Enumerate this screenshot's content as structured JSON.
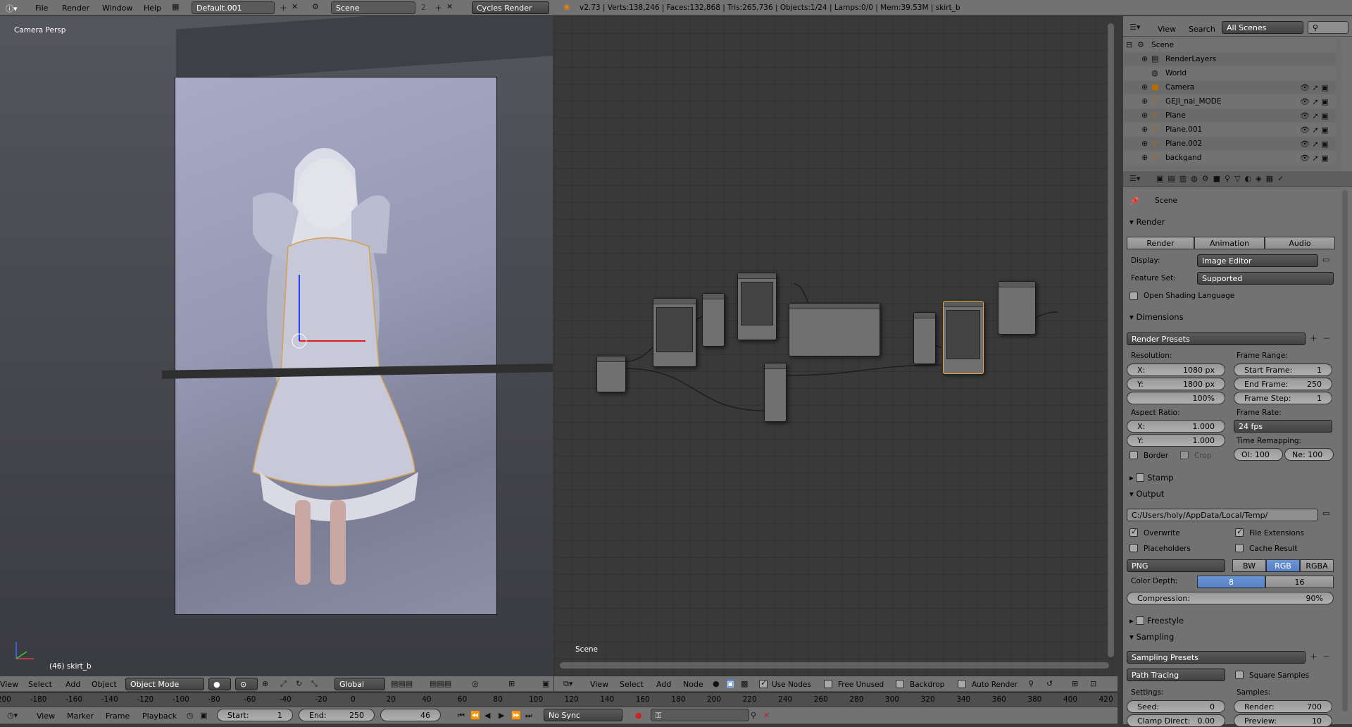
{
  "info_bar": {
    "menu": [
      "File",
      "Render",
      "Window",
      "Help"
    ],
    "screen_layout": "Default.001",
    "scene": "Scene",
    "scene_users": "2",
    "engine": "Cycles Render",
    "stats": "v2.73 | Verts:138,246 | Faces:132,868 | Tris:265,736 | Objects:1/24 | Lamps:0/0 | Mem:39.53M | skirt_b"
  },
  "viewport": {
    "view_name": "Camera Persp",
    "object_label": "(46) skirt_b",
    "header": {
      "menu": [
        "View",
        "Select",
        "Add",
        "Object"
      ],
      "mode": "Object Mode",
      "orientation": "Global"
    }
  },
  "node_editor": {
    "scene_label": "Scene",
    "header": {
      "menu": [
        "View",
        "Select",
        "Add",
        "Node"
      ],
      "use_nodes": "Use Nodes",
      "free_unused": "Free Unused",
      "backdrop": "Backdrop",
      "auto_render": "Auto Render"
    }
  },
  "outliner": {
    "header": {
      "view": "View",
      "search": "Search",
      "filter": "All Scenes"
    },
    "items": [
      {
        "name": "Scene",
        "level": 0
      },
      {
        "name": "RenderLayers",
        "level": 1
      },
      {
        "name": "World",
        "level": 1
      },
      {
        "name": "Camera",
        "level": 1
      },
      {
        "name": "GEJI_nai_MODE",
        "level": 1
      },
      {
        "name": "Plane",
        "level": 1
      },
      {
        "name": "Plane.001",
        "level": 1
      },
      {
        "name": "Plane.002",
        "level": 1
      },
      {
        "name": "backgand",
        "level": 1
      }
    ]
  },
  "properties": {
    "context": "Scene",
    "render": {
      "title": "Render",
      "buttons": [
        "Render",
        "Animation",
        "Audio"
      ],
      "display_label": "Display:",
      "display": "Image Editor",
      "feature_label": "Feature Set:",
      "feature": "Supported",
      "osl": "Open Shading Language"
    },
    "dimensions": {
      "title": "Dimensions",
      "presets": "Render Presets",
      "resolution": "Resolution:",
      "res_x": "X:",
      "res_x_val": "1080 px",
      "res_y": "Y:",
      "res_y_val": "1800 px",
      "res_pct": "100%",
      "frame_range": "Frame Range:",
      "start_frame": "Start Frame:",
      "start_val": "1",
      "end_frame": "End Frame:",
      "end_val": "250",
      "frame_step": "Frame Step:",
      "step_val": "1",
      "aspect": "Aspect Ratio:",
      "asp_x": "X:",
      "asp_x_val": "1.000",
      "asp_y": "Y:",
      "asp_y_val": "1.000",
      "frame_rate": "Frame Rate:",
      "fps": "24 fps",
      "time_remap": "Time Remapping:",
      "old": "Ol: 100",
      "new": "Ne: 100",
      "border": "Border",
      "crop": "Crop"
    },
    "stamp": "Stamp",
    "output": {
      "title": "Output",
      "path": "C:/Users/holy/AppData/Local/Temp/",
      "overwrite": "Overwrite",
      "file_ext": "File Extensions",
      "placeholders": "Placeholders",
      "cache": "Cache Result",
      "format": "PNG",
      "bw": "BW",
      "rgb": "RGB",
      "rgba": "RGBA",
      "depth_label": "Color Depth:",
      "d8": "8",
      "d16": "16",
      "compression": "Compression:",
      "compression_val": "90%"
    },
    "freestyle": "Freestyle",
    "sampling": {
      "title": "Sampling",
      "presets": "Sampling Presets",
      "integrator": "Path Tracing",
      "square": "Square Samples",
      "settings": "Settings:",
      "samples": "Samples:",
      "seed": "Seed:",
      "seed_val": "0",
      "render": "Render:",
      "render_val": "700",
      "clamp": "Clamp Direct:",
      "clamp_val": "0.00",
      "preview": "Preview:",
      "preview_val": "10"
    }
  },
  "timeline": {
    "ticks": [
      "-200",
      "-180",
      "-160",
      "-140",
      "-120",
      "-100",
      "-80",
      "-60",
      "-40",
      "-20",
      "0",
      "20",
      "40",
      "60",
      "80",
      "100",
      "120",
      "140",
      "160",
      "180",
      "200",
      "220",
      "240",
      "260",
      "280",
      "300",
      "320",
      "340",
      "360",
      "380",
      "400",
      "420"
    ],
    "menu": [
      "View",
      "Marker",
      "Frame",
      "Playback"
    ],
    "start": "Start:",
    "start_val": "1",
    "end": "End:",
    "end_val": "250",
    "current": "46",
    "sync": "No Sync"
  },
  "colors": {
    "accent_blue": "#5680c2",
    "selected_orange": "#f2a33a",
    "bg_dark": "#393939",
    "header": "#727272"
  }
}
